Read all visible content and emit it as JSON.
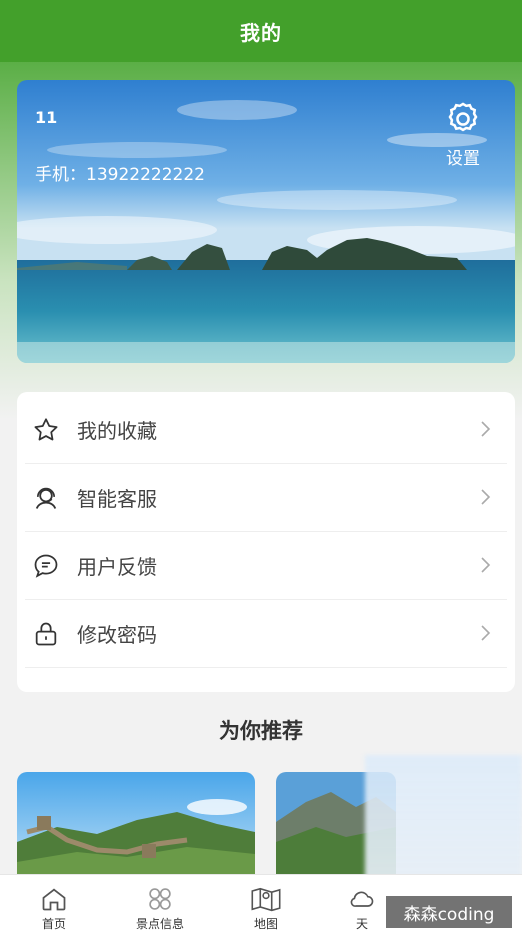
{
  "header": {
    "title": "我的"
  },
  "profile": {
    "uid": "11",
    "phone_label": "手机：",
    "phone": "13922222222",
    "settings_label": "设置"
  },
  "menu": {
    "items": [
      {
        "label": "我的收藏",
        "icon": "star-icon"
      },
      {
        "label": "智能客服",
        "icon": "customer-service-icon"
      },
      {
        "label": "用户反馈",
        "icon": "chat-bubble-icon"
      },
      {
        "label": "修改密码",
        "icon": "lock-icon"
      }
    ]
  },
  "recommend": {
    "title": "为你推荐"
  },
  "tabbar": {
    "items": [
      {
        "label": "首页",
        "icon": "home-icon"
      },
      {
        "label": "景点信息",
        "icon": "grid-icon"
      },
      {
        "label": "地图",
        "icon": "map-icon"
      },
      {
        "label": "天",
        "icon": "weather-icon"
      }
    ]
  },
  "watermark": {
    "text": "森森coding"
  },
  "colors": {
    "brand_green": "#43a02b",
    "page_bg": "#f2f2f2"
  }
}
